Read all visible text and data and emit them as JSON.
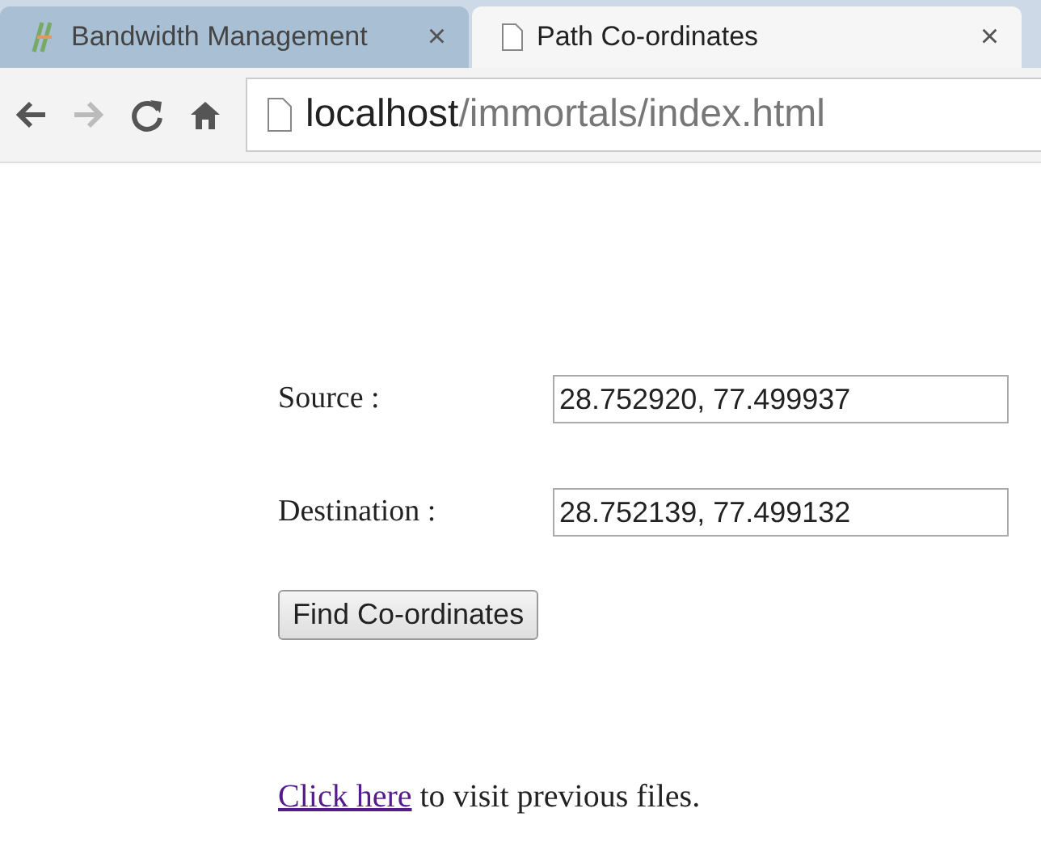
{
  "tabs": [
    {
      "title": "Bandwidth Management",
      "close": "×",
      "selected": false
    },
    {
      "title": "Path Co-ordinates",
      "close": "×",
      "selected": true
    }
  ],
  "address_bar": {
    "host": "localhost",
    "path": "/immortals/index.html"
  },
  "form": {
    "fields": [
      {
        "label": "Source :",
        "value": "28.752920, 77.499937"
      },
      {
        "label": "Destination :",
        "value": "28.752139, 77.499132"
      }
    ],
    "button": "Find Co-ordinates"
  },
  "footer": {
    "link": "Click here",
    "text": " to visit previous files."
  }
}
